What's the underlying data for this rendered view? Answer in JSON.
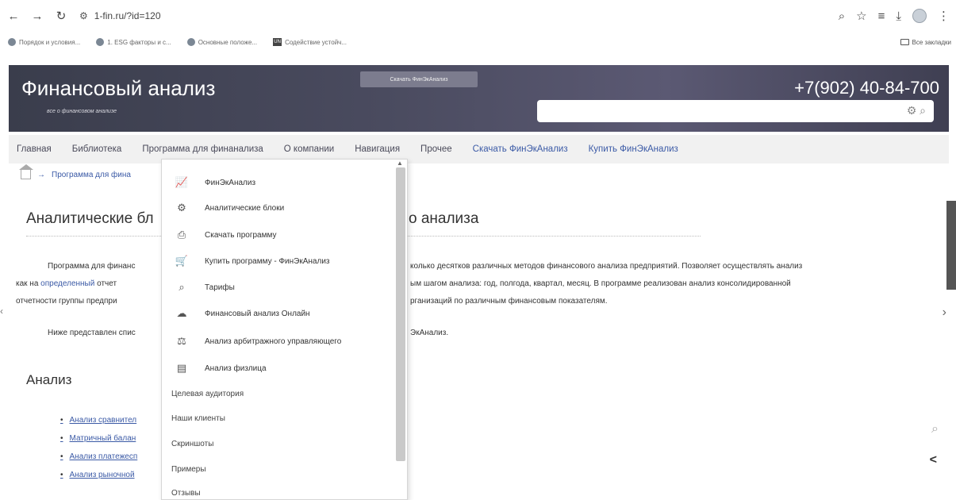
{
  "browser": {
    "url": "1-fin.ru/?id=120",
    "bookmarks": [
      "Порядок и условия...",
      "1. ESG факторы и с...",
      "Основные положе...",
      "Содействие устойч..."
    ],
    "all_bookmarks": "Все закладки"
  },
  "header": {
    "logo": "Финансовый анализ",
    "tagline": "все о финансовом анализе",
    "download_button": "Скачать ФинЭкАнализ",
    "phone": "+7(902) 40-84-700"
  },
  "nav": {
    "items": [
      "Главная",
      "Библиотека",
      "Программа для финанализа",
      "О компании",
      "Навигация",
      "Прочее",
      "Скачать ФинЭкАнализ",
      "Купить ФинЭкАнализ"
    ]
  },
  "breadcrumb": {
    "current": "Программа для фина"
  },
  "main": {
    "title_left": "Аналитические бл",
    "title_right": "о анализа",
    "para_1_left": "Программа для финанс",
    "para_1_right": "колько десятков различных методов финансового анализа предприятий. Позволяет осуществлять анализ",
    "para_2_left_a": "как на ",
    "para_2_left_link": "определенный",
    "para_2_left_b": " отчет",
    "para_2_right": "ым шагом анализа: год, полгода, квартал, месяц. В программе реализован анализ консолидированной",
    "para_3_left": "отчетности группы предпри",
    "para_3_right": "рганизаций по различным финансовым показателям.",
    "para_4_left": "Ниже представлен спис",
    "para_4_right": "ЭкАнализ.",
    "section_title": "Анализ",
    "bullets": [
      "Анализ сравнител",
      "Матричный балан",
      "Анализ платежесп",
      "Анализ рыночной"
    ]
  },
  "dropdown": {
    "items": [
      {
        "label": "ФинЭкАнализ",
        "icon": "chart-icon"
      },
      {
        "label": "Аналитические блоки",
        "icon": "gear-icon"
      },
      {
        "label": "Скачать программу",
        "icon": "download-icon"
      },
      {
        "label": "Купить программу - ФинЭкАнализ",
        "icon": "cart-icon"
      },
      {
        "label": "Тарифы",
        "icon": "search-tag-icon"
      },
      {
        "label": "Финансовый анализ Онлайн",
        "icon": "cloud-icon"
      },
      {
        "label": "Анализ арбитражного управляющего",
        "icon": "scales-icon"
      },
      {
        "label": "Анализ физлица",
        "icon": "document-icon"
      }
    ],
    "plain_items": [
      "Целевая аудитория",
      "Наши клиенты",
      "Скриншоты",
      "Примеры",
      "Отзывы"
    ]
  }
}
